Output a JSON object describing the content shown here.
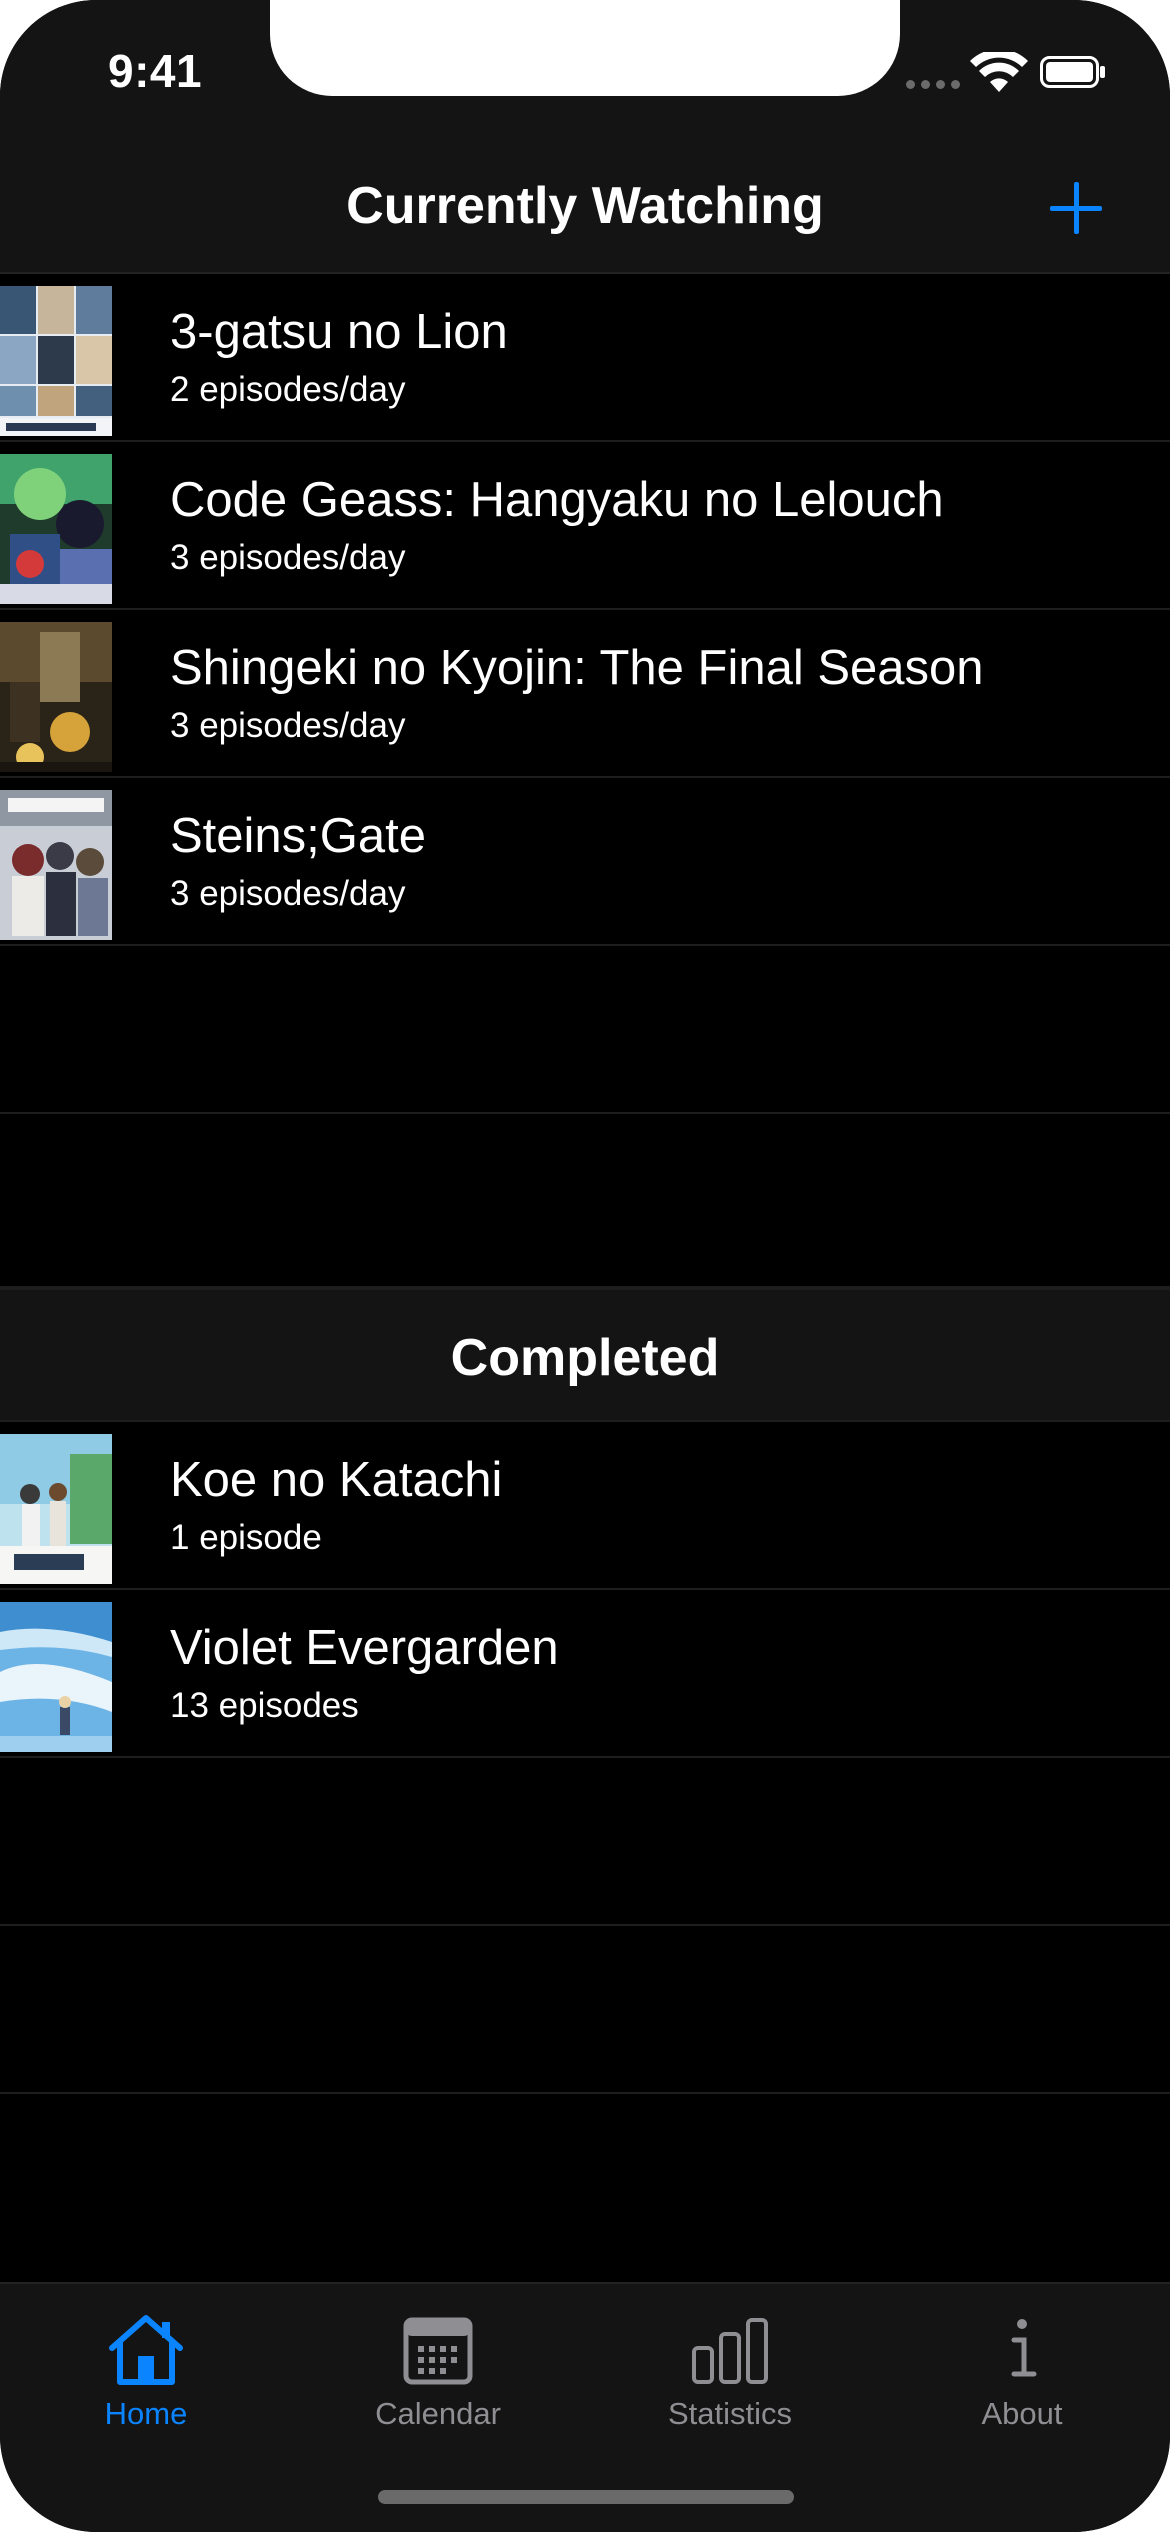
{
  "status_bar": {
    "time": "9:41"
  },
  "nav": {
    "title": "Currently Watching",
    "add_icon": "plus-icon"
  },
  "currently_watching": [
    {
      "title": "3-gatsu no Lion",
      "subtitle": "2 episodes/day"
    },
    {
      "title": "Code Geass: Hangyaku no Lelouch",
      "subtitle": "3 episodes/day"
    },
    {
      "title": "Shingeki no Kyojin: The Final Season",
      "subtitle": "3 episodes/day"
    },
    {
      "title": "Steins;Gate",
      "subtitle": "3 episodes/day"
    }
  ],
  "completed_section": {
    "title": "Completed"
  },
  "completed": [
    {
      "title": "Koe no Katachi",
      "subtitle": "1 episode"
    },
    {
      "title": "Violet Evergarden",
      "subtitle": "13 episodes"
    }
  ],
  "tab_bar": {
    "tabs": [
      {
        "label": "Home",
        "icon": "house-icon",
        "active": true
      },
      {
        "label": "Calendar",
        "icon": "calendar-icon",
        "active": false
      },
      {
        "label": "Statistics",
        "icon": "bar-chart-icon",
        "active": false
      },
      {
        "label": "About",
        "icon": "info-icon",
        "active": false
      }
    ]
  },
  "colors": {
    "accent": "#0a84ff",
    "background": "#000000",
    "bar_background": "#141414",
    "inactive": "#8e8e93"
  }
}
